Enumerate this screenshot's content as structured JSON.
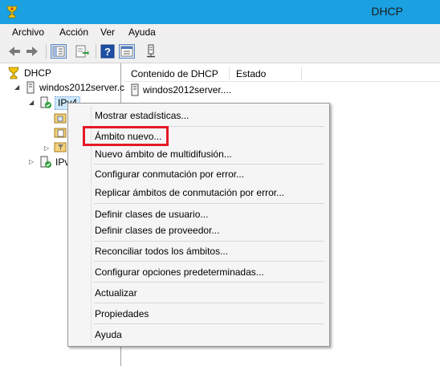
{
  "window": {
    "title": "DHCP"
  },
  "menu": {
    "items": [
      "Archivo",
      "Acción",
      "Ver",
      "Ayuda"
    ]
  },
  "toolbar": {
    "buttons": [
      "back-icon",
      "forward-icon",
      "show-hide-tree-icon",
      "export-list-icon",
      "help-icon",
      "properties-icon",
      "server-icon"
    ]
  },
  "tree": {
    "root": "DHCP",
    "server": "windos2012server.c",
    "ipv4": "IPv4",
    "ipv6": "IPv"
  },
  "list": {
    "columns": [
      "Contenido de DHCP",
      "Estado"
    ],
    "rows": [
      {
        "name": "windos2012server...."
      }
    ]
  },
  "context_menu": {
    "items": [
      "Mostrar estadísticas...",
      "Ámbito nuevo...",
      "Nuevo ámbito de multidifusión...",
      "Configurar conmutación por error...",
      "Replicar ámbitos de conmutación por error...",
      "Definir clases de usuario...",
      "Definir clases de proveedor...",
      "Reconciliar todos los ámbitos...",
      "Configurar opciones predeterminadas...",
      "Actualizar",
      "Propiedades",
      "Ayuda"
    ],
    "highlighted": "Ámbito nuevo...",
    "highlight_color": "#e31b23"
  },
  "colors": {
    "titlebar": "#1ba1e2",
    "menubar": "#f0f0f0",
    "menu_bg": "#f5f5f5"
  }
}
